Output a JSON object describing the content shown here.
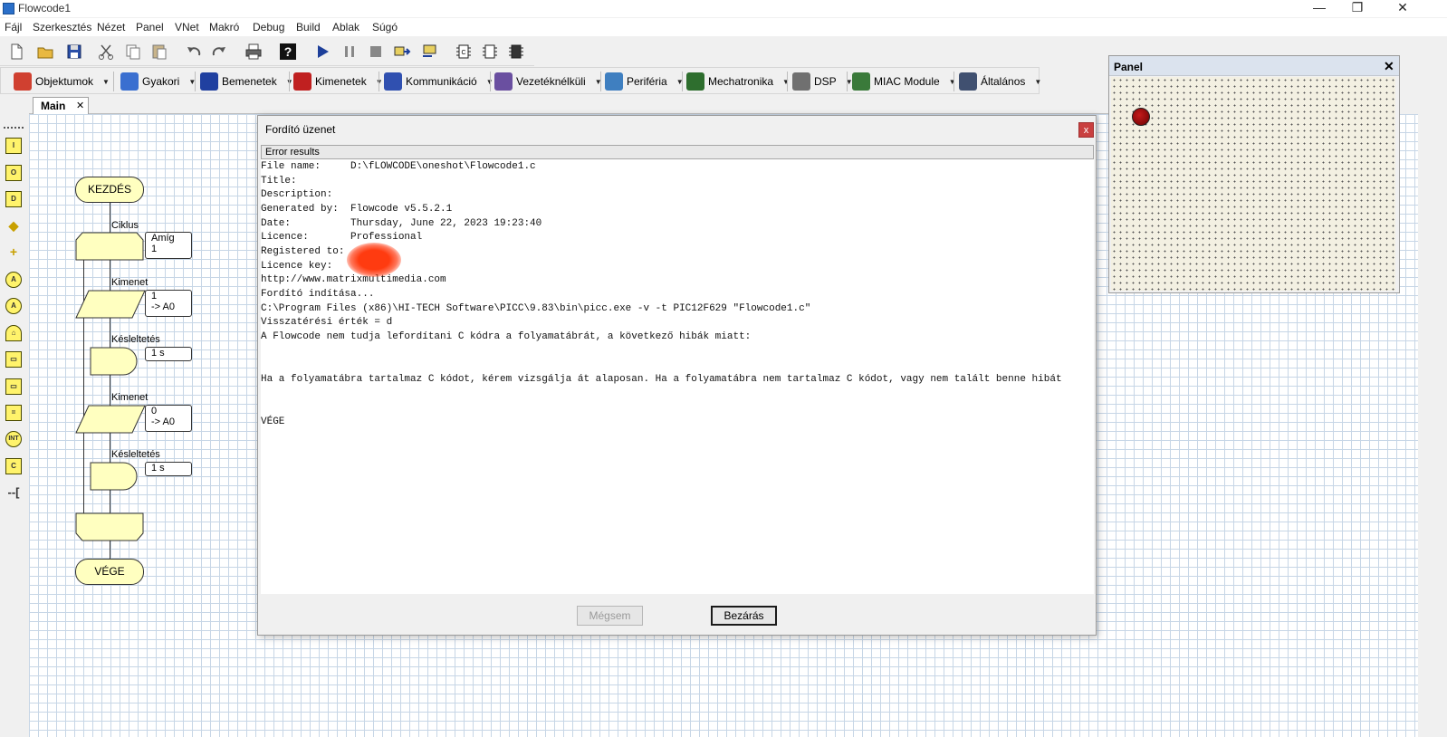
{
  "window": {
    "title": "Flowcode1",
    "minimize": "—",
    "restore": "❐",
    "close": "✕"
  },
  "menu": [
    "Fájl",
    "Szerkesztés",
    "Nézet",
    "Panel",
    "VNet",
    "Makró",
    "Debug",
    "Build",
    "Ablak",
    "Súgó"
  ],
  "toolbar": {
    "icons": [
      "new-file-icon",
      "open-folder-icon",
      "save-icon",
      "cut-icon",
      "copy-icon",
      "paste-icon",
      "undo-icon",
      "redo-icon",
      "print-icon",
      "help-icon",
      "run-icon",
      "pause-icon",
      "stop-icon",
      "step-into-icon",
      "step-over-icon",
      "compile-c-icon",
      "compile-hex-icon",
      "compile-chip-icon"
    ]
  },
  "components": [
    {
      "label": "Objektumok",
      "color": "#d04030"
    },
    {
      "label": "Gyakori",
      "color": "#3a6fd0"
    },
    {
      "label": "Bemenetek",
      "color": "#2040a0"
    },
    {
      "label": "Kimenetek",
      "color": "#c02020"
    },
    {
      "label": "Kommunikáció",
      "color": "#3050b0"
    },
    {
      "label": "Vezetéknélküli",
      "color": "#6a4fa0"
    },
    {
      "label": "Periféria",
      "color": "#3f7fc0"
    },
    {
      "label": "Mechatronika",
      "color": "#2e6e2e"
    },
    {
      "label": "DSP",
      "color": "#707070"
    },
    {
      "label": "MIAC Module",
      "color": "#3a7a3a"
    },
    {
      "label": "Általános",
      "color": "#405070"
    }
  ],
  "tab": {
    "label": "Main",
    "close": "✕"
  },
  "palette": [
    "I",
    "O",
    "D",
    "◆",
    "+",
    "A",
    "A",
    "⌂",
    "▭",
    "▭",
    "=",
    "INT",
    "C",
    "--["
  ],
  "flowchart": {
    "start": "KEZDÉS",
    "end": "VÉGE",
    "loop_label": "Ciklus",
    "loop_note_1": "Amíg",
    "loop_note_2": "1",
    "output1_label": "Kimenet",
    "output1_note_1": "1",
    "output1_note_2": "-> A0",
    "delay1_label": "Késleltetés",
    "delay1_note": "1 s",
    "output2_label": "Kimenet",
    "output2_note_1": "0",
    "output2_note_2": "-> A0",
    "delay2_label": "Késleltetés",
    "delay2_note": "1 s"
  },
  "dialog": {
    "title": "Fordító üzenet",
    "close": "x",
    "header": "Error results",
    "lines": [
      "File name:     D:\\fLOWCODE\\oneshot\\Flowcode1.c",
      "Title:",
      "Description:",
      "Generated by:  Flowcode v5.5.2.1",
      "Date:          Thursday, June 22, 2023 19:23:40",
      "Licence:       Professional",
      "Registered to:",
      "Licence key:",
      "http://www.matrixmultimedia.com",
      "Fordító indítása...",
      "C:\\Program Files (x86)\\HI-TECH Software\\PICC\\9.83\\bin\\picc.exe -v -t PIC12F629 \"Flowcode1.c\"",
      "Visszatérési érték = d",
      "A Flowcode nem tudja lefordítani C kódra a folyamatábrát, a következő hibák miatt:",
      "",
      "",
      "Ha a folyamatábra tartalmaz C kódot, kérem vizsgálja át alaposan. Ha a folyamatábra nem tartalmaz C kódot, vagy nem talált benne hibát",
      "",
      "",
      "VÉGE"
    ],
    "cancel_label": "Mégsem",
    "close_label": "Bezárás"
  },
  "panel": {
    "title": "Panel",
    "close": "✕"
  }
}
